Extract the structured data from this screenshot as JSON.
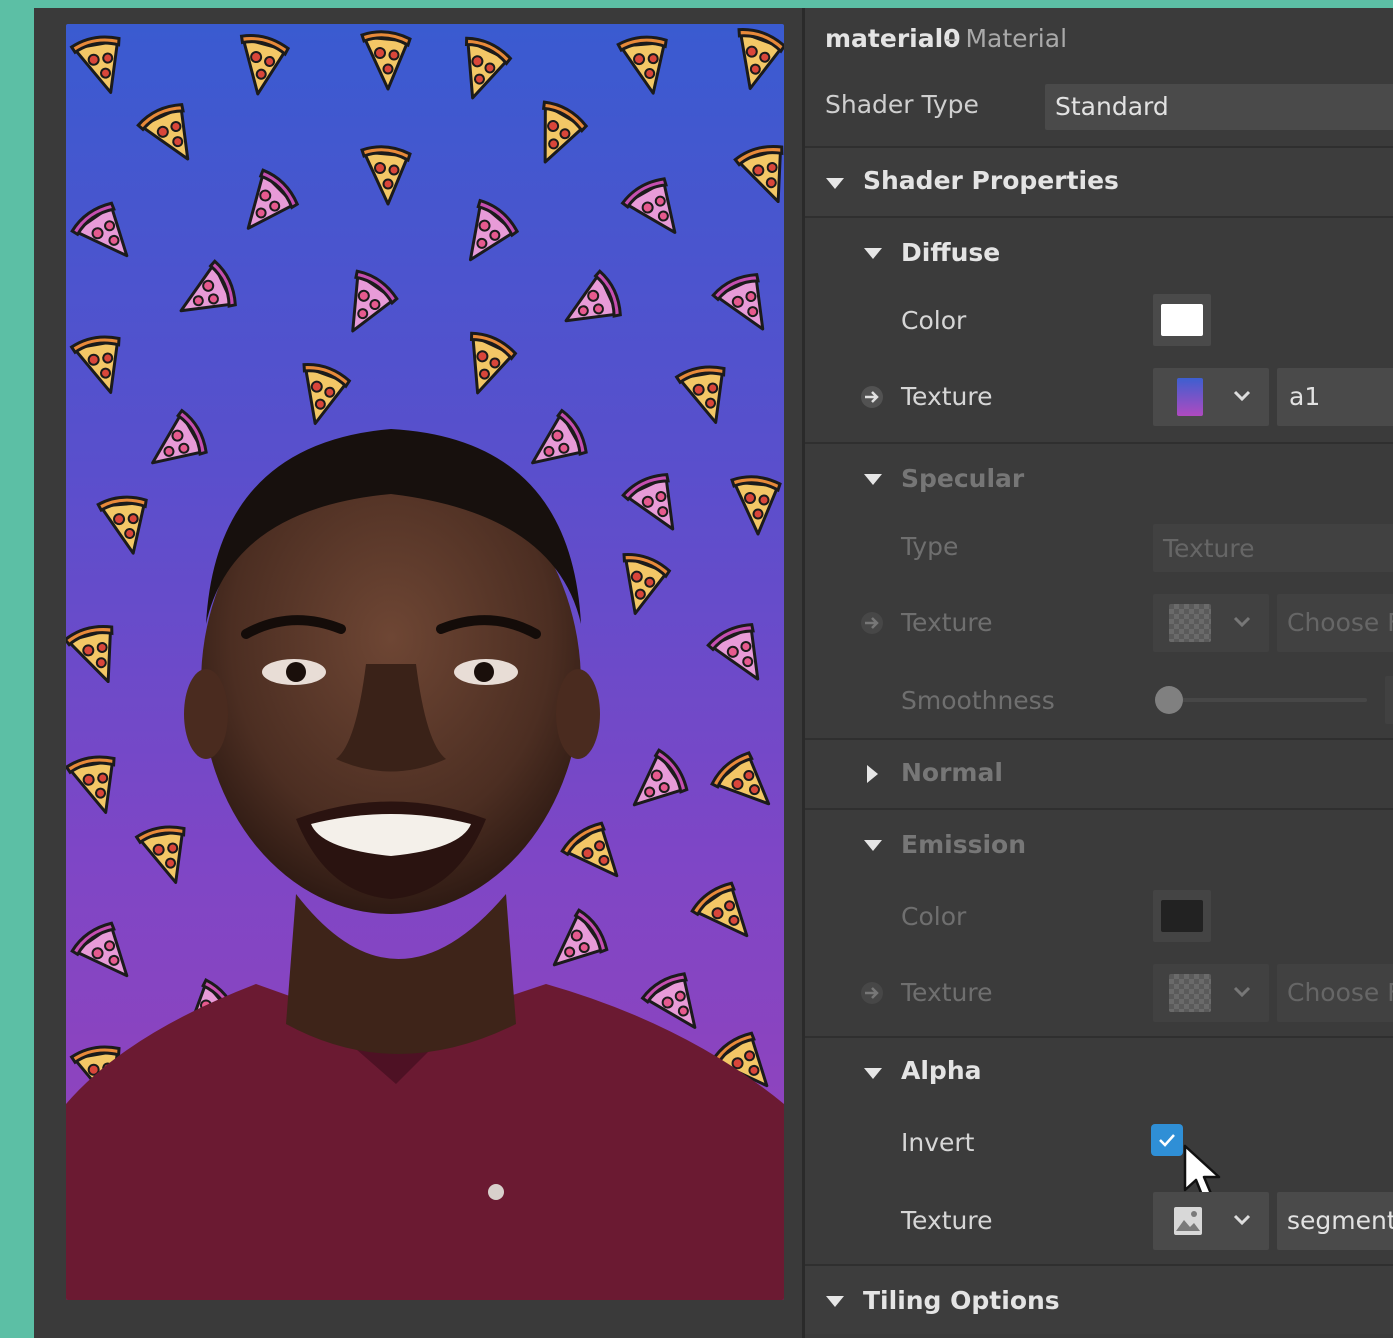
{
  "header": {
    "title": "material0",
    "subtitle": "– Material"
  },
  "shader_type": {
    "label": "Shader Type",
    "value": "Standard"
  },
  "sections": {
    "shader_properties": "Shader Properties",
    "diffuse": "Diffuse",
    "specular": "Specular",
    "normal": "Normal",
    "emission": "Emission",
    "alpha": "Alpha",
    "tiling": "Tiling Options"
  },
  "diffuse": {
    "color_label": "Color",
    "color_value": "#ffffff",
    "texture_label": "Texture",
    "texture_value": "a1"
  },
  "specular": {
    "type_label": "Type",
    "type_value": "Texture",
    "texture_label": "Texture",
    "texture_value": "Choose File",
    "smoothness_label": "Smoothness",
    "smoothness_value": "0"
  },
  "emission": {
    "color_label": "Color",
    "color_value": "#222222",
    "texture_label": "Texture",
    "texture_value": "Choose File"
  },
  "alpha": {
    "invert_label": "Invert",
    "invert_checked": true,
    "texture_label": "Texture",
    "texture_value": "segmentatio"
  },
  "colors": {
    "accent": "#2f8fd6",
    "panel_bg": "#3b3b3b",
    "page_bg": "#5cbfa5"
  }
}
